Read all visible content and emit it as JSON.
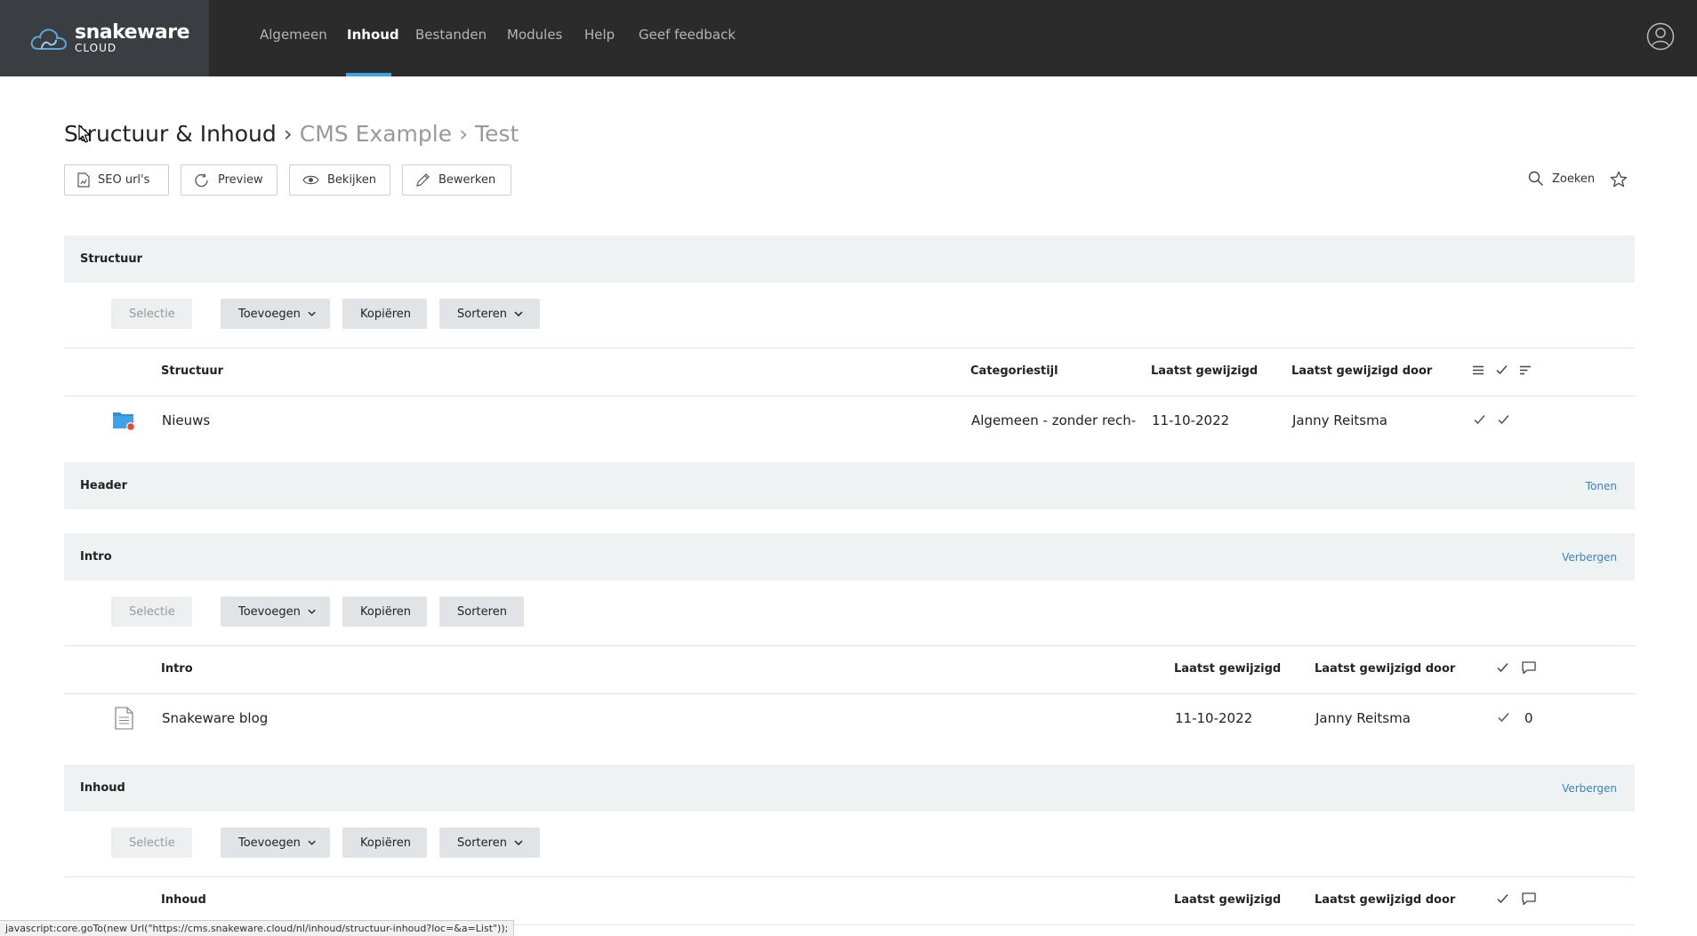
{
  "navbar": {
    "brand": "snakeware",
    "brand_sub": "CLOUD",
    "items": [
      {
        "label": "Algemeen"
      },
      {
        "label": "Inhoud"
      },
      {
        "label": "Bestanden"
      },
      {
        "label": "Modules"
      },
      {
        "label": "Help"
      },
      {
        "label": "Geef feedback"
      }
    ],
    "active_item": "Inhoud",
    "accent_color": "#3aa6e8"
  },
  "breadcrumb": {
    "main": "Structuur & Inhoud",
    "separator": "›",
    "items": [
      "CMS Example",
      "Test"
    ]
  },
  "toolbar": {
    "seo_label": "SEO url's",
    "preview_label": "Preview",
    "bekijken_label": "Bekijken",
    "bewerken_label": "Bewerken",
    "search_label": "Zoeken"
  },
  "sections": {
    "structuur": {
      "title": "Structuur",
      "controls": {
        "selectie": "Selectie",
        "toevoegen": "Toevoegen",
        "kopieren": "Kopiëren",
        "sorteren": "Sorteren"
      },
      "columns": {
        "name": "Structuur",
        "style": "Categoriestijl",
        "modified": "Laatst gewijzigd",
        "modified_by": "Laatst gewijzigd door"
      },
      "rows": [
        {
          "name": "Nieuws",
          "style": "Algemeen - zonder rech-",
          "modified": "11-10-2022",
          "modified_by": "Janny Reitsma",
          "icon": "folder-icon"
        }
      ]
    },
    "header": {
      "title": "Header",
      "toggle": "Tonen"
    },
    "intro": {
      "title": "Intro",
      "toggle": "Verbergen",
      "controls": {
        "selectie": "Selectie",
        "toevoegen": "Toevoegen",
        "kopieren": "Kopiëren",
        "sorteren": "Sorteren"
      },
      "columns": {
        "name": "Intro",
        "modified": "Laatst gewijzigd",
        "modified_by": "Laatst gewijzigd door"
      },
      "rows": [
        {
          "name": "Snakeware blog",
          "modified": "11-10-2022",
          "modified_by": "Janny Reitsma",
          "comments": "0",
          "icon": "document-icon"
        }
      ]
    },
    "inhoud": {
      "title": "Inhoud",
      "toggle": "Verbergen",
      "controls": {
        "selectie": "Selectie",
        "toevoegen": "Toevoegen",
        "kopieren": "Kopiëren",
        "sorteren": "Sorteren"
      },
      "columns": {
        "name": "Inhoud",
        "modified": "Laatst gewijzigd",
        "modified_by": "Laatst gewijzigd door"
      }
    }
  },
  "statusbar": {
    "text": "javascript:core.goTo(new Url(\"https://cms.snakeware.cloud/nl/inhoud/structuur-inhoud?loc=&a=List\"));"
  }
}
